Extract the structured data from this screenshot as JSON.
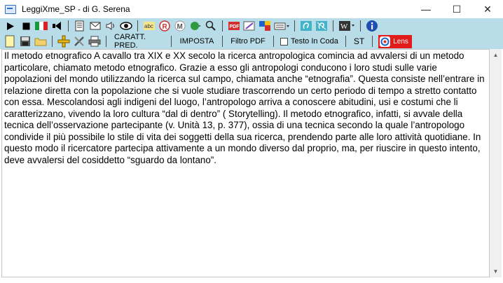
{
  "window": {
    "title": "LeggiXme_SP - di G. Serena",
    "controls": {
      "minimize": "—",
      "maximize": "☐",
      "close": "✕"
    }
  },
  "toolbar1": {
    "icons": [
      "play-icon",
      "stop-icon",
      "italian-flag-icon",
      "speaker-back-icon",
      "book-icon",
      "email-icon",
      "volume-icon",
      "eye-icon",
      "spellcheck-icon",
      "recognize-r-icon",
      "recognize-m-icon",
      "green-arrow-icon",
      "search-icon",
      "pdf-icon",
      "edit-icon",
      "translate-icon",
      "keyboard-icon",
      "listen-ear-icon",
      "listen-ear-2-icon",
      "wikipedia-icon",
      "info-icon"
    ]
  },
  "toolbar2": {
    "buttons": {
      "caratt_pred": "CARATT. PRED.",
      "imposta": "IMPOSTA",
      "filtro_pdf": "Filtro PDF",
      "testo_in_coda": "Testo In Coda",
      "st": "ST",
      "lens": "Lens"
    }
  },
  "document": {
    "text": "Il metodo etnografico A cavallo tra XIX e XX secolo la ricerca antropologica comincia ad avvalersi di un metodo particolare, chiamato metodo etnografico. Grazie a esso gli antropologi conducono i loro studi sulle varie popolazioni del mondo utilizzando la ricerca sul campo, chiamata anche “etnografia”. Questa consiste nell’entrare in relazione diretta con la popolazione che si vuole studiare trascorrendo un certo periodo di tempo a stretto contatto con essa. Mescolandosi agli indigeni del luogo, l’antropologo arriva a conoscere abitudini, usi e costumi che li caratterizzano, vivendo la loro cultura “dal di dentro” ( Storytelling). Il metodo etnografico, infatti, si avvale della tecnica dell’osservazione partecipante (v. Unità 13, p. 377), ossia di una tecnica secondo la quale l’antropologo condivide il più possibile lo stile di vita dei soggetti della sua ricerca, prendendo parte alle loro attività quotidiane. In questo modo il ricercatore partecipa attivamente a un mondo diverso dal proprio, ma, per riuscire in questo intento, deve avvalersi del cosiddetto “sguardo da lontano”."
  },
  "colors": {
    "toolbar_bg": "#b9dde8",
    "lens_bg": "#e21b1b"
  }
}
